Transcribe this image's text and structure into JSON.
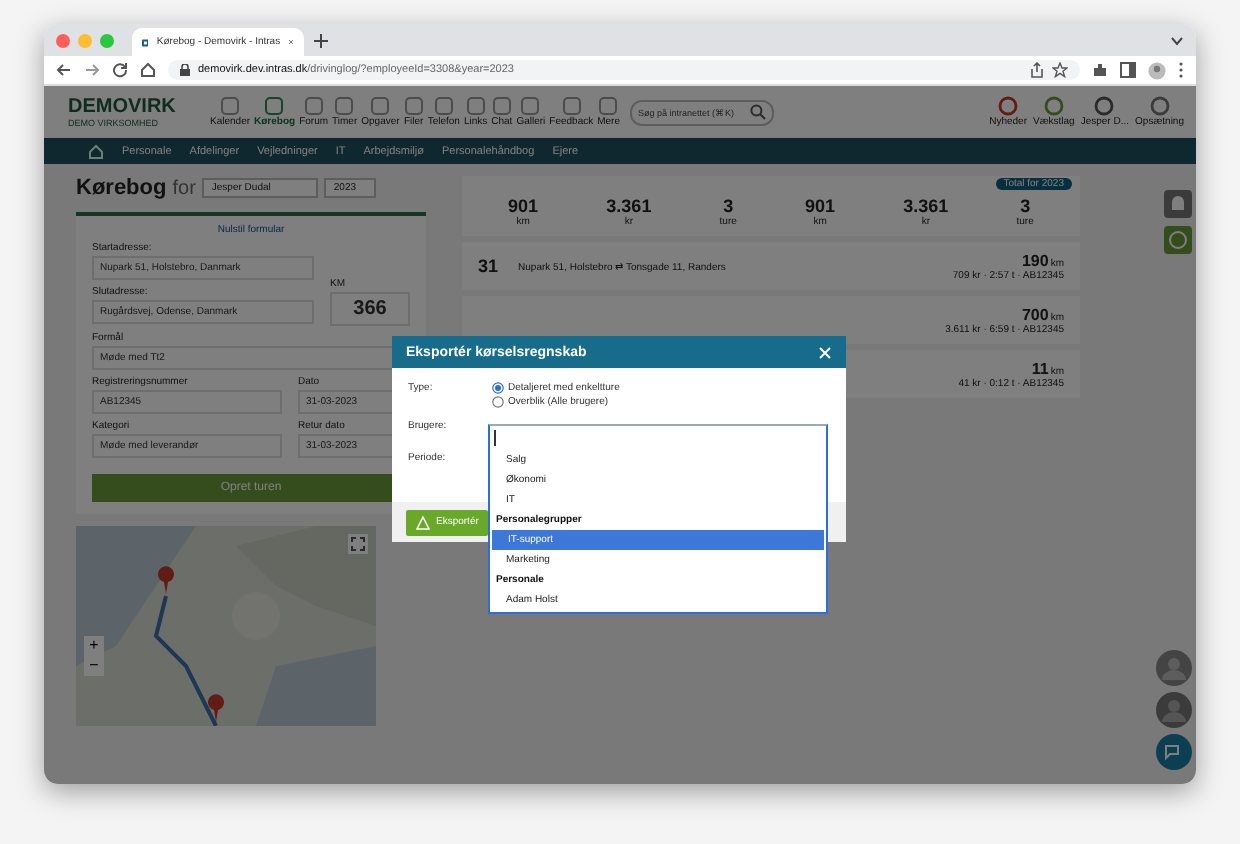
{
  "browser": {
    "tab_title": "Kørebog - Demovirk - Intras",
    "url_host": "demovirk.dev.intras.dk",
    "url_path": "/drivinglog/?employeeId=3308&year=2023"
  },
  "header": {
    "logo": "DEMOVIRK",
    "logo_sub": "DEMO VIRKSOMHED",
    "apps": [
      {
        "label": "Kalender",
        "selected": false
      },
      {
        "label": "Kørebog",
        "selected": true
      },
      {
        "label": "Forum",
        "selected": false
      },
      {
        "label": "Timer",
        "selected": false
      },
      {
        "label": "Opgaver",
        "selected": false
      },
      {
        "label": "Filer",
        "selected": false
      },
      {
        "label": "Telefon",
        "selected": false
      },
      {
        "label": "Links",
        "selected": false
      },
      {
        "label": "Chat",
        "selected": false
      },
      {
        "label": "Galleri",
        "selected": false
      },
      {
        "label": "Feedback",
        "selected": false
      },
      {
        "label": "Mere",
        "selected": false
      }
    ],
    "search_placeholder": "Søg på intranettet (⌘K)",
    "user_items": [
      "Nyheder",
      "Vækstlag",
      "Jesper D...",
      "Opsætning"
    ]
  },
  "nav": [
    "Personale",
    "Afdelinger",
    "Vejledninger",
    "IT",
    "Arbejdsmiljø",
    "Personalehåndbog",
    "Ejere"
  ],
  "form": {
    "title": "Kørebog",
    "title_for": "for",
    "employee": "Jesper Dudal",
    "year": "2023",
    "reset": "Nulstil formular",
    "fields": [
      {
        "label": "Startadresse:",
        "value": "Nupark 51, Holstebro, Danmark"
      },
      {
        "label": "Slutadresse:",
        "value": "Rugårdsvej, Odense, Danmark"
      },
      {
        "label": "Formål",
        "value": "Møde med Tt2"
      },
      {
        "label": "Registreringsnummer",
        "value": "AB12345"
      },
      {
        "label": "Kategori",
        "value": "Møde med leverandør"
      }
    ],
    "km_label": "KM",
    "km": "366",
    "date_label": "Dato",
    "date": "31-03-2023",
    "return_label": "Retur dato",
    "return_date": "31-03-2023",
    "submit": "Opret turen"
  },
  "map": {
    "zoom_in": "+",
    "zoom_out": "−"
  },
  "summary": {
    "badge": "Total for 2023",
    "groups": [
      {
        "stats": [
          {
            "value": "901",
            "unit": "km"
          },
          {
            "value": "3.361",
            "unit": "kr"
          },
          {
            "value": "3",
            "unit": "ture"
          }
        ]
      },
      {
        "stats": [
          {
            "value": "901",
            "unit": "km"
          },
          {
            "value": "3.361",
            "unit": "kr"
          },
          {
            "value": "3",
            "unit": "ture"
          }
        ]
      }
    ]
  },
  "trips": [
    {
      "day": "31",
      "route": "Nupark 51, Holstebro ⇄ Tonsgade 11, Randers",
      "km": "190",
      "unit": "km",
      "details": "709 kr · 2:57 t · AB12345"
    },
    {
      "km": "700",
      "unit": "km",
      "details": "3.611 kr · 6:59 t · AB12345"
    },
    {
      "km": "11",
      "unit": "km",
      "details": "41 kr · 0:12 t · AB12345"
    }
  ],
  "dialog": {
    "title": "Eksportér kørselsregnskab",
    "type_label": "Type:",
    "types": [
      {
        "label": "Detaljeret med enkeltture",
        "selected": true
      },
      {
        "label": "Overblik (Alle brugere)",
        "selected": false
      }
    ],
    "users_label": "Brugere:",
    "period_label": "Periode:",
    "export": "Eksportér",
    "options": [
      {
        "kind": "option",
        "label": "Salg",
        "selected": false
      },
      {
        "kind": "option",
        "label": "Økonomi",
        "selected": false
      },
      {
        "kind": "option",
        "label": "IT",
        "selected": false
      },
      {
        "kind": "group",
        "label": "Personalegrupper"
      },
      {
        "kind": "option",
        "label": "IT-support",
        "selected": true
      },
      {
        "kind": "option",
        "label": "Marketing",
        "selected": false
      },
      {
        "kind": "group",
        "label": "Personale"
      },
      {
        "kind": "option",
        "label": "Adam Holst",
        "selected": false
      }
    ]
  }
}
